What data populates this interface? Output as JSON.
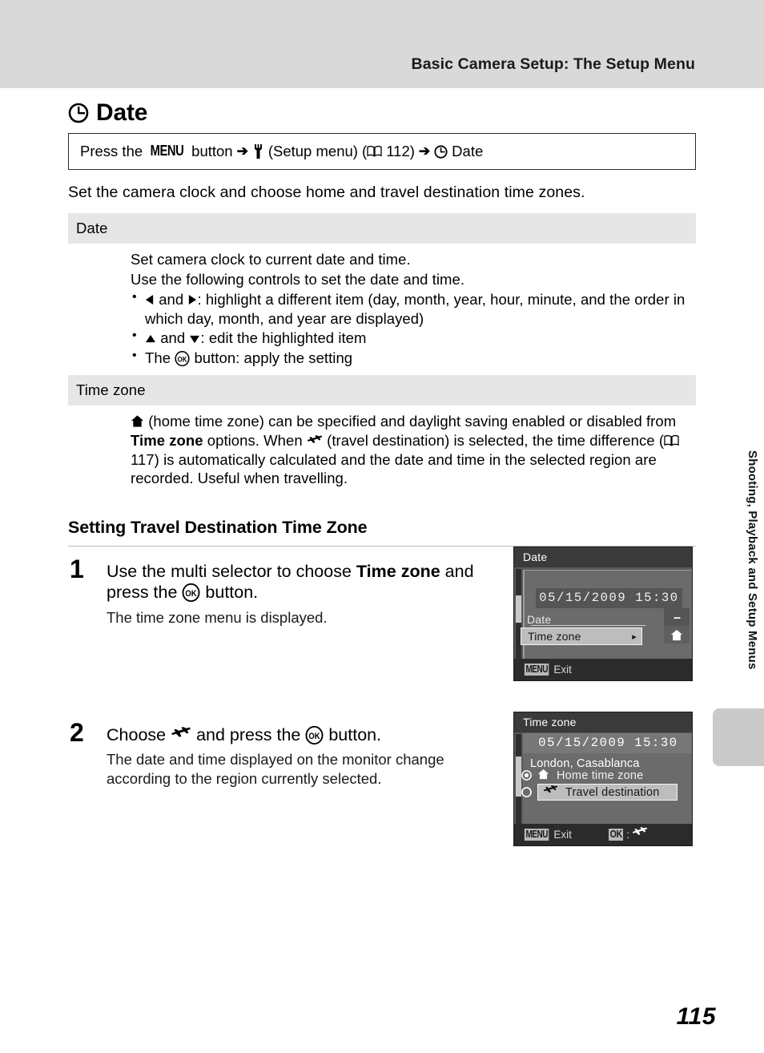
{
  "header": {
    "running_title": "Basic Camera Setup: The Setup Menu"
  },
  "chapter": {
    "icon": "clock-icon",
    "title": "Date"
  },
  "nav_path": {
    "press_the": "Press the",
    "menu_key": "MENU",
    "button_word": "button",
    "arrow1": "➔",
    "setup_icon": "wrench-icon",
    "setup_label": "(Setup menu)",
    "book_icon": "book-icon",
    "page_ref": "112",
    "arrow2": "➔",
    "date_icon": "clock-icon",
    "date_label": "Date"
  },
  "intro": "Set the camera clock and choose home and travel destination time zones.",
  "options": [
    {
      "name": "Date",
      "lines": [
        "Set camera clock to current date and time.",
        "Use the following controls to set the date and time."
      ],
      "bullets": [
        {
          "icon_left": "triangle-left-icon",
          "icon_right": "triangle-right-icon",
          "text_a": "and",
          "text_b": ": highlight a different item (day, month, year, hour, minute, and the order in which day, month, and year are displayed)"
        },
        {
          "icon_left": "triangle-up-icon",
          "icon_right": "triangle-down-icon",
          "text_a": "and",
          "text_b": ": edit the highlighted item"
        },
        {
          "prefix": "The",
          "icon": "ok-button-icon",
          "text_b": "button: apply the setting"
        }
      ]
    },
    {
      "name": "Time zone",
      "paragraph_parts": {
        "p1": "(home time zone) can be specified and daylight saving enabled or disabled from",
        "bold1": "Time zone",
        "p2": "options. When",
        "p3": "(travel destination) is selected, the time difference",
        "page_ref": "117",
        "p4": "is automatically calculated and the date and time in the selected region are recorded. Useful when travelling.",
        "home_icon": "home-icon",
        "plane_icon": "airplane-icon",
        "book_icon": "book-icon"
      }
    }
  ],
  "section": {
    "heading": "Setting Travel Destination Time Zone"
  },
  "steps": [
    {
      "number": "1",
      "lead_a": "Use the multi selector to choose",
      "lead_bold": "Time zone",
      "lead_b": "and press the",
      "lead_icon": "ok-button-icon",
      "lead_c": "button.",
      "sub": "The time zone menu is displayed."
    },
    {
      "number": "2",
      "lead_a": "Choose",
      "lead_icon_plane": "airplane-icon",
      "lead_b": "and press the",
      "lead_icon": "ok-button-icon",
      "lead_c": "button.",
      "sub": "The date and time displayed on the monitor change according to the region currently selected."
    }
  ],
  "screenshot_1": {
    "title": "Date",
    "datetime": "05/15/2009  15:30",
    "rows": [
      {
        "label": "Date",
        "chip": "--",
        "selected": false
      },
      {
        "label": "Time zone",
        "chip": "home-icon",
        "selected": true,
        "arrow": "▸"
      }
    ],
    "footer": {
      "menu_chip": "MENU",
      "menu_label": "Exit"
    }
  },
  "screenshot_2": {
    "title": "Time zone",
    "datetime": "05/15/2009  15:30",
    "city": "London, Casablanca",
    "rows": [
      {
        "radio": "radio-selected",
        "icon": "home-icon",
        "label": "Home time zone",
        "highlighted": false
      },
      {
        "radio": "radio-empty",
        "icon": "airplane-icon",
        "label": "Travel destination",
        "highlighted": true
      }
    ],
    "footer": {
      "menu_chip": "MENU",
      "menu_label": "Exit",
      "ok_chip": "OK",
      "ok_sep": ":",
      "ok_icon": "airplane-icon"
    }
  },
  "side_index": {
    "text": "Shooting, Playback and Setup Menus"
  },
  "folio": "115",
  "colors": {
    "header_band": "#d9d9d9",
    "table_head": "#e6e6e6",
    "screen_bg": "#5a5a5a",
    "screen_title_bar": "#3a3a3a",
    "screen_footer": "#2b2b2b",
    "highlight": "#bdbdbd",
    "side_tab": "#c9c9c9"
  }
}
